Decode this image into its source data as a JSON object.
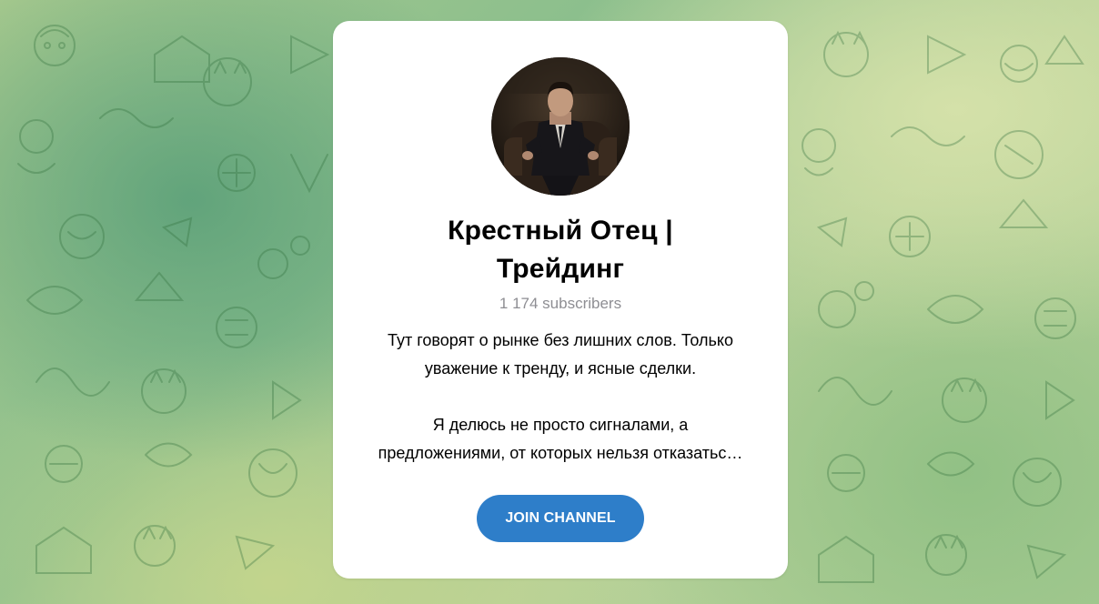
{
  "channel": {
    "title_line1": "Крестный Отец |",
    "title_line2": "Трейдинг",
    "subscribers": "1 174 subscribers",
    "description": {
      "line1": "Тут говорят о рынке без лишних слов. Только",
      "line2": "уважение к тренду, и ясные сделки.",
      "line3": "Я делюсь не просто сигналами, а",
      "line4": "предложениями, от которых нельзя отказатьс…"
    },
    "join_label": "JOIN CHANNEL"
  },
  "colors": {
    "accent": "#2e7ec9",
    "card": "#ffffff",
    "muted_text": "#8e8e93",
    "background_green": "#8cbf8d"
  },
  "icons": {
    "avatar": "channel-avatar-photo",
    "background": "doodle-pattern"
  }
}
